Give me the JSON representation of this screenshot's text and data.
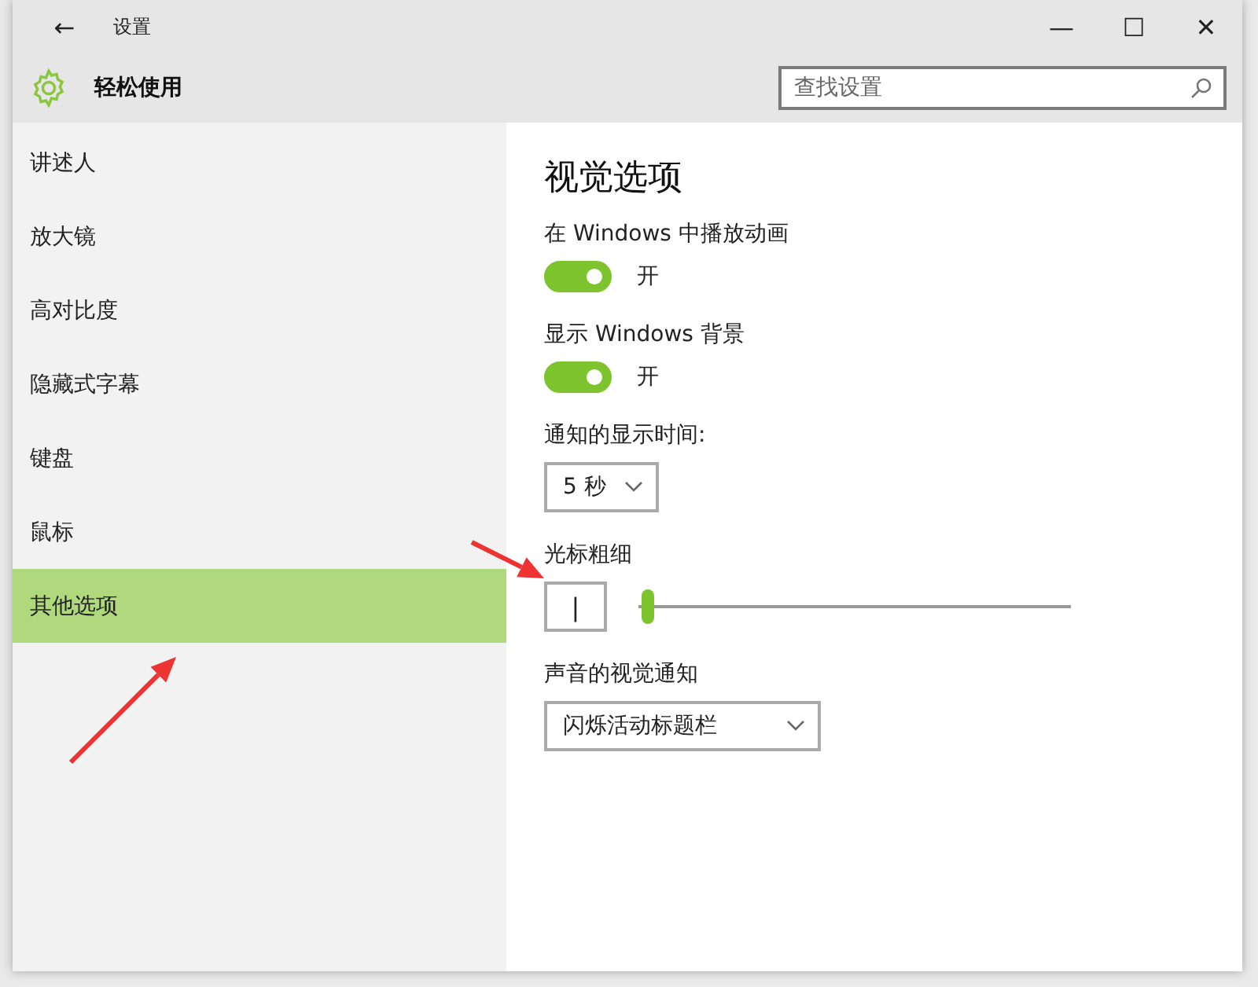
{
  "window": {
    "title": "设置",
    "back": "←",
    "controls": [
      "—",
      "☐",
      "✕"
    ]
  },
  "header": {
    "title": "轻松使用",
    "search": {
      "placeholder": "查找设置"
    }
  },
  "sidebar": {
    "items": [
      {
        "label": "讲述人",
        "selected": false
      },
      {
        "label": "放大镜",
        "selected": false
      },
      {
        "label": "高对比度",
        "selected": false
      },
      {
        "label": "隐藏式字幕",
        "selected": false
      },
      {
        "label": "键盘",
        "selected": false
      },
      {
        "label": "鼠标",
        "selected": false
      },
      {
        "label": "其他选项",
        "selected": true
      }
    ]
  },
  "content": {
    "heading": "视觉选项",
    "settings": [
      {
        "kind": "toggle",
        "label": "在 Windows 中播放动画",
        "on": true,
        "state_text": "开"
      },
      {
        "kind": "toggle",
        "label": "显示 Windows 背景",
        "on": true,
        "state_text": "开"
      },
      {
        "kind": "dropdown",
        "label": "通知的显示时间:",
        "value": "5 秒"
      },
      {
        "kind": "slider",
        "label": "光标粗细",
        "preview": "|",
        "level": 0.02
      },
      {
        "kind": "dropdown",
        "label": "声音的视觉通知",
        "value": "闪烁活动标题栏"
      }
    ]
  }
}
